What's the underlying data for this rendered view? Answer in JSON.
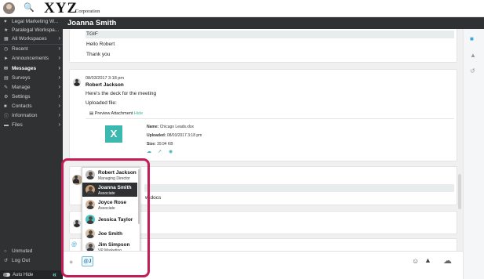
{
  "brand": {
    "logo_text": "XYZ",
    "logo_sub": "Corporation"
  },
  "sidebar": {
    "items": [
      {
        "label": "Legal Marketing W...",
        "icon": "heart-icon"
      },
      {
        "label": "Paralegal Workspa...",
        "icon": "star-icon"
      },
      {
        "label": "All Workspaces",
        "icon": "grid-icon"
      },
      {
        "label": "Recent",
        "icon": "clock-icon"
      },
      {
        "label": "Announcements",
        "icon": "megaphone-icon"
      },
      {
        "label": "Messages",
        "icon": "message-icon"
      },
      {
        "label": "Surveys",
        "icon": "survey-icon"
      },
      {
        "label": "Manage",
        "icon": "pencil-icon"
      },
      {
        "label": "Settings",
        "icon": "gear-icon"
      },
      {
        "label": "Contacts",
        "icon": "contacts-icon"
      },
      {
        "label": "Information",
        "icon": "info-icon"
      },
      {
        "label": "Files",
        "icon": "folder-icon"
      }
    ],
    "bottom": [
      {
        "label": "Unmuted",
        "icon": "bell-icon"
      },
      {
        "label": "Log Out",
        "icon": "logout-icon"
      }
    ],
    "auto_hide_label": "Auto Hide"
  },
  "header": {
    "title": "Joanna Smith"
  },
  "messages": {
    "first": {
      "lines": [
        "TGIF",
        "Hello Robert",
        "Thank you"
      ]
    },
    "second": {
      "date": "08/03/2017 3:18 pm",
      "author": "Robert Jackson",
      "text": "Here's the deck for the meeting",
      "uploaded": "Uploaded file:",
      "preview_label": "Preview Attachment",
      "hide_label": "Hide",
      "file_icon_text": "X",
      "file": {
        "name_label": "Name:",
        "name": "Chicago Leads.xlsx",
        "uploaded_label": "Uploaded:",
        "uploaded": "08/03/2017 3:18 pm",
        "size_label": "Size:",
        "size": "39.94 KB"
      }
    },
    "third_partial": "w docs"
  },
  "mention_list": [
    {
      "name": "Robert Jackson",
      "role": "Managing Director",
      "selected": false
    },
    {
      "name": "Joanna Smith",
      "role": "Associate",
      "selected": true
    },
    {
      "name": "Joyce Rose",
      "role": "Associate",
      "selected": false
    },
    {
      "name": "Jessica Taylor",
      "role": "",
      "selected": false
    },
    {
      "name": "Joe Smith",
      "role": "",
      "selected": false
    },
    {
      "name": "Jim Simpson",
      "role": "VP Marketing",
      "selected": false
    }
  ],
  "composer": {
    "value": "@J"
  },
  "colors": {
    "sidebar": "#2f3133",
    "accent": "#3bb8b0",
    "highlight": "#c41c56"
  }
}
